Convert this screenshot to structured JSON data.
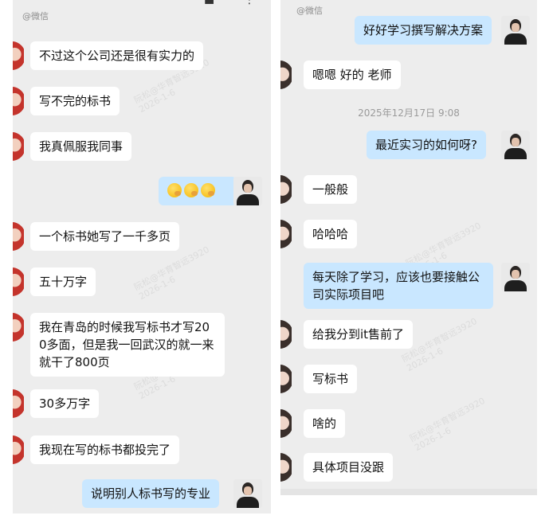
{
  "left_panel": {
    "app_mark": "@微信",
    "watermark_lines": [
      "阮松@华育智远3920",
      "2026-1-6"
    ],
    "messages": [
      {
        "side": "in",
        "text": "不过这个公司还是很有实力的"
      },
      {
        "side": "in",
        "text": "写不完的标书"
      },
      {
        "side": "in",
        "text": "我真佩服我同事"
      },
      {
        "side": "out",
        "text": "",
        "emoji": [
          "thinking-face",
          "thinking-face",
          "thinking-face"
        ]
      },
      {
        "side": "in",
        "text": "一个标书她写了一千多页"
      },
      {
        "side": "in",
        "text": "五十万字"
      },
      {
        "side": "in",
        "text": "我在青岛的时候我写标书才写200多面，但是我一回武汉的就一来就干了800页"
      },
      {
        "side": "in",
        "text": "30多万字"
      },
      {
        "side": "in",
        "text": "我现在写的标书都投完了"
      },
      {
        "side": "out",
        "text": "说明别人标书写的专业"
      }
    ]
  },
  "right_panel": {
    "app_mark": "@微信",
    "timestamp": "2025年12月17日  9:08",
    "messages": [
      {
        "side": "out",
        "text": "好好学习撰写解决方案"
      },
      {
        "side": "in",
        "text": "嗯嗯 好的 老师"
      },
      {
        "side": "out",
        "text": "最近实习的如何呀?"
      },
      {
        "side": "in",
        "text": "一般般"
      },
      {
        "side": "in",
        "text": "哈哈哈"
      },
      {
        "side": "out",
        "text": "每天除了学习，应该也要接触公司实际项目吧"
      },
      {
        "side": "in",
        "text": "给我分到it售前了"
      },
      {
        "side": "in",
        "text": "写标书"
      },
      {
        "side": "in",
        "text": "啥的"
      },
      {
        "side": "in",
        "text": "具体项目没跟"
      }
    ]
  },
  "colors": {
    "panel_bg": "#ededed",
    "bubble_in": "#ffffff",
    "bubble_out": "#c9e7ff",
    "text": "#111111",
    "timestamp": "#9a9a9a"
  }
}
